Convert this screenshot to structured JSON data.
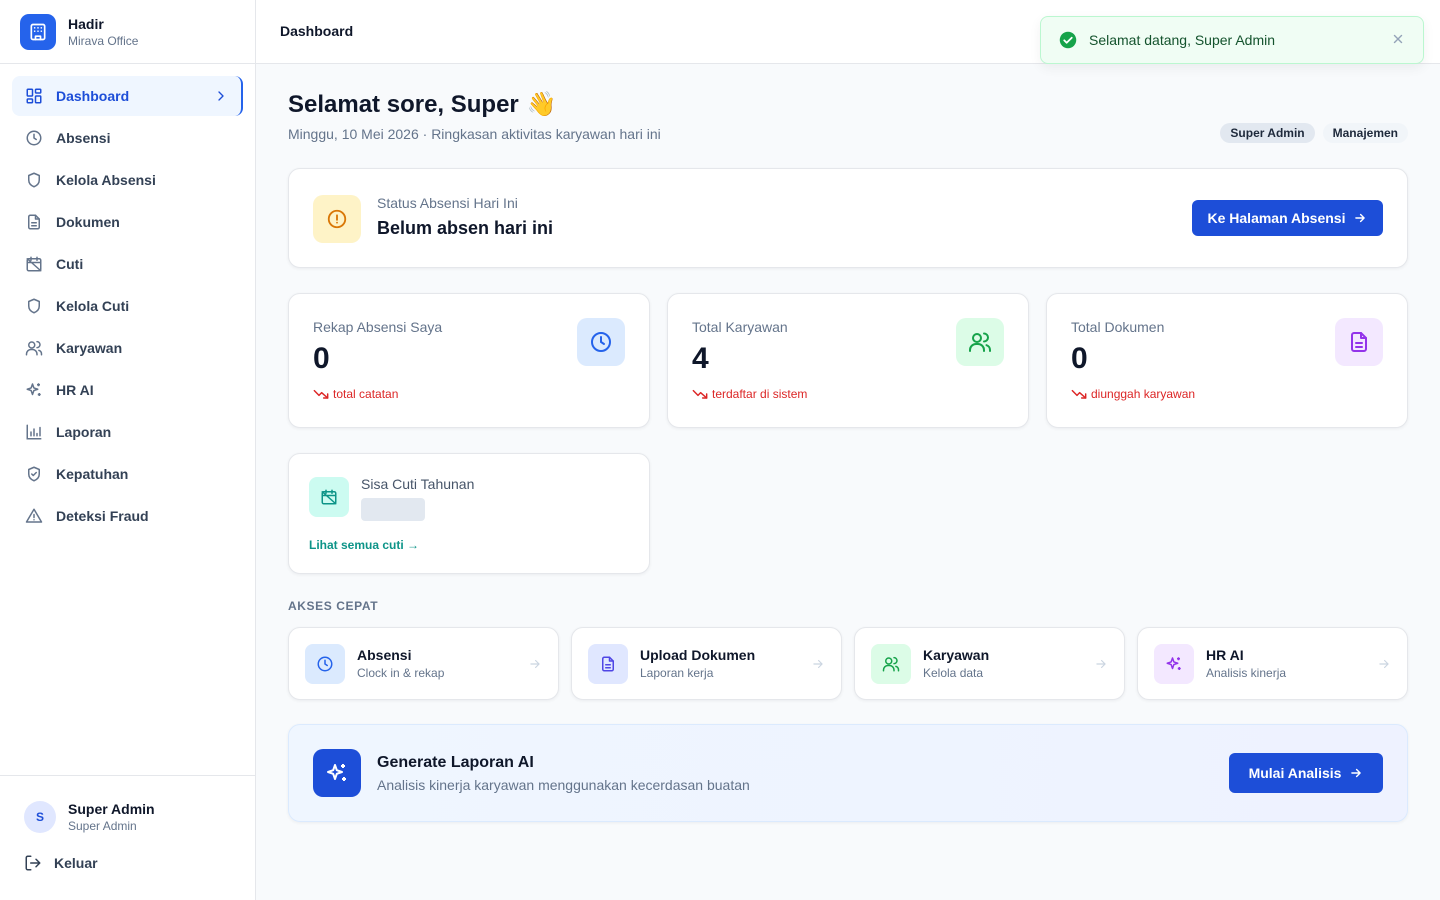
{
  "brand": {
    "name": "Hadir",
    "subtitle": "Mirava Office"
  },
  "sidebar": {
    "items": [
      {
        "label": "Dashboard",
        "icon": "dashboard-grid-icon",
        "active": true
      },
      {
        "label": "Absensi",
        "icon": "clock-icon"
      },
      {
        "label": "Kelola Absensi",
        "icon": "shield-icon"
      },
      {
        "label": "Dokumen",
        "icon": "document-icon"
      },
      {
        "label": "Cuti",
        "icon": "calendar-off-icon"
      },
      {
        "label": "Kelola Cuti",
        "icon": "shield-icon"
      },
      {
        "label": "Karyawan",
        "icon": "users-icon"
      },
      {
        "label": "HR AI",
        "icon": "sparkles-icon"
      },
      {
        "label": "Laporan",
        "icon": "bar-chart-icon"
      },
      {
        "label": "Kepatuhan",
        "icon": "shield-check-icon"
      },
      {
        "label": "Deteksi Fraud",
        "icon": "alert-triangle-icon"
      }
    ]
  },
  "user": {
    "initial": "S",
    "name": "Super Admin",
    "role": "Super Admin"
  },
  "logout_label": "Keluar",
  "header": {
    "title": "Dashboard"
  },
  "toast": {
    "message": "Selamat datang, Super Admin",
    "icon": "check-circle-icon"
  },
  "greeting": {
    "title": "Selamat sore, Super",
    "emoji": "👋",
    "subtitle": "Minggu, 10 Mei 2026 · Ringkasan aktivitas karyawan hari ini"
  },
  "badges": [
    "Super Admin",
    "Manajemen"
  ],
  "status": {
    "label": "Status Absensi Hari Ini",
    "value": "Belum absen hari ini",
    "button": "Ke Halaman Absensi"
  },
  "stats": [
    {
      "label": "Rekap Absensi Saya",
      "value": "0",
      "trend": "total catatan",
      "icon": "clock-icon",
      "color": "#2563eb",
      "bg": "#dbeafe"
    },
    {
      "label": "Total Karyawan",
      "value": "4",
      "trend": "terdaftar di sistem",
      "icon": "users-icon",
      "color": "#16a34a",
      "bg": "#dcfce7"
    },
    {
      "label": "Total Dokumen",
      "value": "0",
      "trend": "diunggah karyawan",
      "icon": "document-icon",
      "color": "#9333ea",
      "bg": "#f3e8ff"
    }
  ],
  "leave": {
    "label": "Sisa Cuti Tahunan",
    "link": "Lihat semua cuti →"
  },
  "quick_access": {
    "title": "AKSES CEPAT",
    "items": [
      {
        "title": "Absensi",
        "subtitle": "Clock in & rekap",
        "icon": "clock-icon",
        "color": "#2563eb",
        "bg": "#dbeafe"
      },
      {
        "title": "Upload Dokumen",
        "subtitle": "Laporan kerja",
        "icon": "document-icon",
        "color": "#4f46e5",
        "bg": "#e0e7ff"
      },
      {
        "title": "Karyawan",
        "subtitle": "Kelola data",
        "icon": "users-icon",
        "color": "#16a34a",
        "bg": "#dcfce7"
      },
      {
        "title": "HR AI",
        "subtitle": "Analisis kinerja",
        "icon": "sparkles-icon",
        "color": "#9333ea",
        "bg": "#f3e8ff"
      }
    ]
  },
  "ai_report": {
    "title": "Generate Laporan AI",
    "subtitle": "Analisis kinerja karyawan menggunakan kecerdasan buatan",
    "button": "Mulai Analisis"
  }
}
